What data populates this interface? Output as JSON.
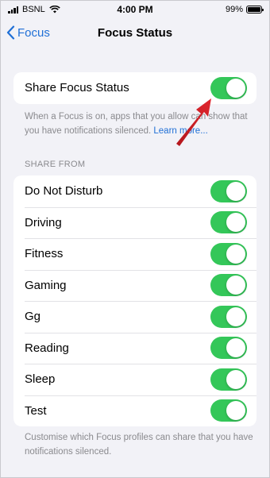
{
  "status_bar": {
    "carrier": "BSNL",
    "time": "4:00 PM",
    "battery": "99%"
  },
  "nav": {
    "back_label": "Focus",
    "title": "Focus Status"
  },
  "share_focus": {
    "label": "Share Focus Status",
    "enabled": true,
    "description_start": "When a Focus is on, apps that you allow can show that you have notifications silenced.",
    "learn_more": "Learn more..."
  },
  "share_from": {
    "header": "SHARE FROM",
    "items": [
      {
        "label": "Do Not Disturb",
        "enabled": true
      },
      {
        "label": "Driving",
        "enabled": true
      },
      {
        "label": "Fitness",
        "enabled": true
      },
      {
        "label": "Gaming",
        "enabled": true
      },
      {
        "label": "Gg",
        "enabled": true
      },
      {
        "label": "Reading",
        "enabled": true
      },
      {
        "label": "Sleep",
        "enabled": true
      },
      {
        "label": "Test",
        "enabled": true
      }
    ],
    "footer": "Customise which Focus profiles can share that you have notifications silenced."
  },
  "colors": {
    "toggle_on": "#34c759",
    "link": "#1f6fd6",
    "annotation_arrow": "#d9272e"
  }
}
